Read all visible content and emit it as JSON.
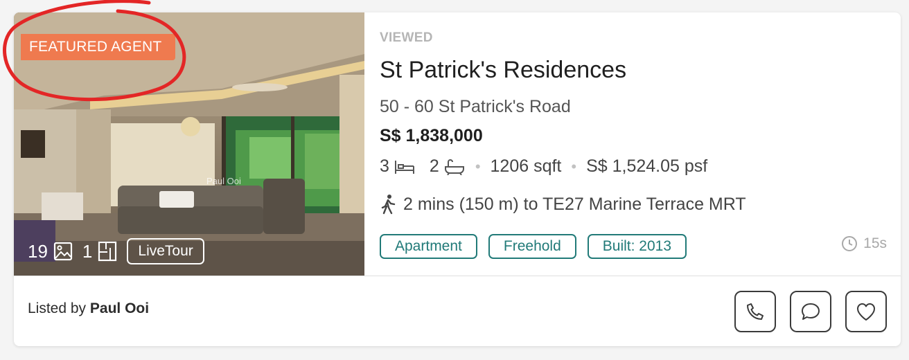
{
  "listing": {
    "badge": "FEATURED AGENT",
    "photo_count": "19",
    "floorplan_count": "1",
    "livetour_label": "LiveTour",
    "watermark": "Paul Ooi",
    "viewed_label": "VIEWED",
    "title": "St Patrick's Residences",
    "address": "50 - 60 St Patrick's Road",
    "price": "S$ 1,838,000",
    "bedrooms": "3",
    "bathrooms": "2",
    "area": "1206 sqft",
    "psf": "S$ 1,524.05 psf",
    "mrt": "2 mins (150 m) to TE27 Marine Terrace MRT",
    "tags": [
      "Apartment",
      "Freehold",
      "Built: 2013"
    ],
    "age": "15s"
  },
  "footer": {
    "listed_prefix": "Listed by",
    "agent_name": "Paul Ooi"
  },
  "icons": {
    "photos": "image-icon",
    "floorplan": "floorplan-icon",
    "bed": "bed-icon",
    "bath": "bathtub-icon",
    "walk": "walking-icon",
    "clock": "clock-icon",
    "call": "phone-icon",
    "chat": "chat-icon",
    "favorite": "heart-icon"
  },
  "colors": {
    "badge": "#ef7a4f",
    "tag": "#217a78",
    "annotation": "#e32626"
  }
}
